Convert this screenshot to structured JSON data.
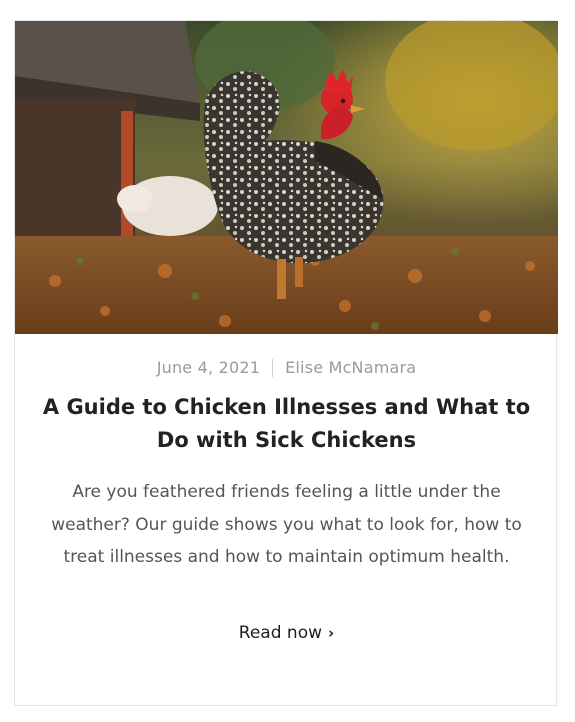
{
  "card": {
    "image_alt": "Rooster standing in autumn leaves",
    "date": "June 4, 2021",
    "author": "Elise McNamara",
    "title": "A Guide to Chicken Illnesses and What to Do with Sick Chickens",
    "excerpt": "Are you feathered friends feeling a little under the weather? Our guide shows you what to look for, how to treat illnesses and how to maintain optimum health.",
    "read_more_label": "Read now",
    "read_more_icon": "chevron-right-icon"
  },
  "colors": {
    "meta_text": "#9a9a9a",
    "title_text": "#222222",
    "body_text": "#555555",
    "card_border": "#e6e6e6"
  }
}
